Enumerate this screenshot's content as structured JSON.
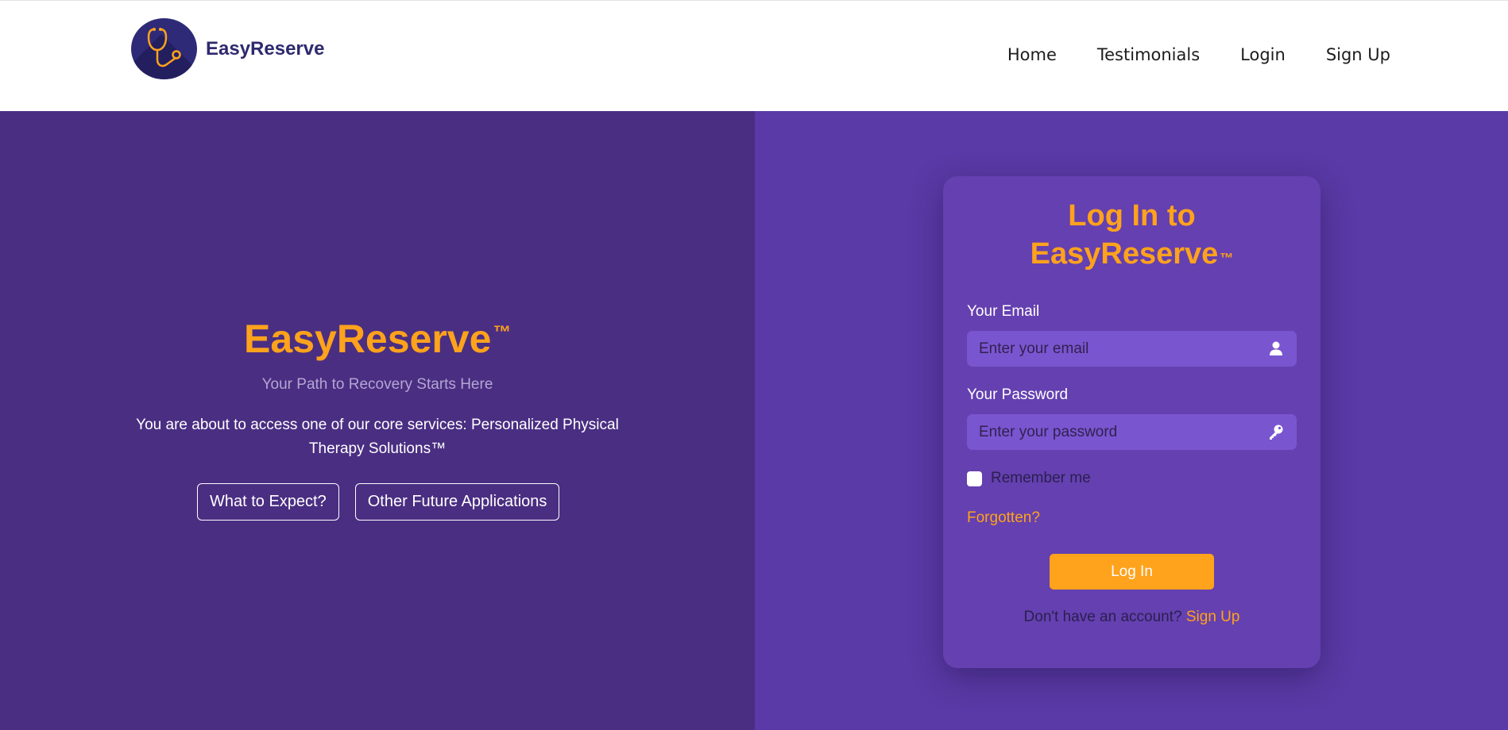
{
  "brand": {
    "name": "EasyReserve",
    "logo_icon": "stethoscope-icon"
  },
  "nav": {
    "items": [
      "Home",
      "Testimonials",
      "Login",
      "Sign Up"
    ]
  },
  "hero": {
    "title": "EasyReserve",
    "trademark": "™",
    "subtitle": "Your Path to Recovery Starts Here",
    "description": "You are about to access one of our core services: Personalized Physical Therapy Solutions™",
    "buttons": [
      "What to Expect?",
      "Other Future Applications"
    ]
  },
  "login": {
    "title_line1": "Log In to",
    "title_line2": "EasyReserve",
    "trademark": "™",
    "email_label": "Your Email",
    "email_placeholder": "Enter your email",
    "email_icon": "user-icon",
    "password_label": "Your Password",
    "password_placeholder": "Enter your password",
    "password_icon": "key-icon",
    "remember_label": "Remember me",
    "remember_checked": false,
    "forgot_label": "Forgotten?",
    "submit_label": "Log In",
    "signup_prompt": "Don't have an account?",
    "signup_link": "Sign Up"
  },
  "colors": {
    "accent": "#ffa21c",
    "left_panel": "#4a2e82",
    "right_panel": "#5a3aa6",
    "card": "#6540b0",
    "input": "#7a55d0",
    "logo_bg": "#2e2a78"
  }
}
